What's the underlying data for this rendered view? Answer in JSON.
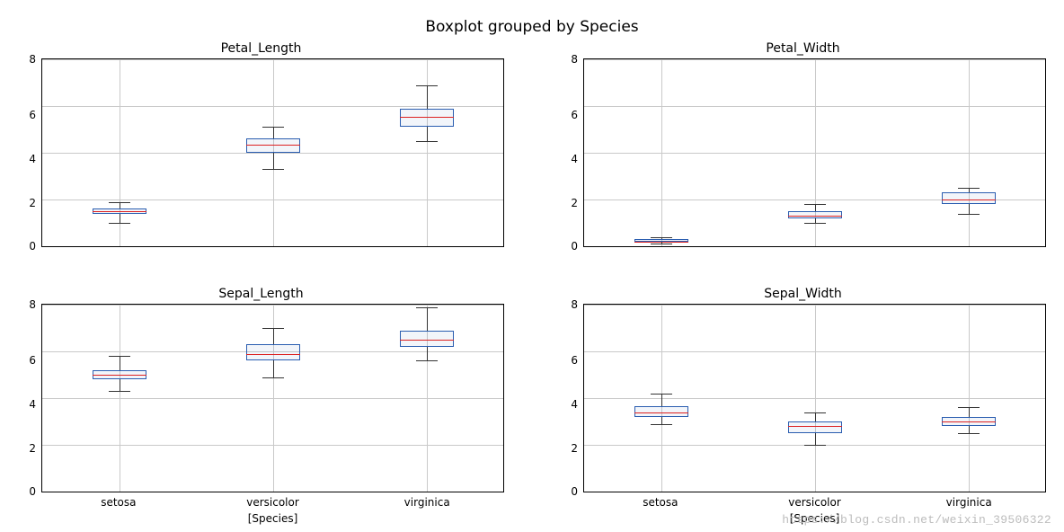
{
  "suptitle": "Boxplot grouped by Species",
  "watermark": "https://blog.csdn.net/weixin_39506322",
  "categories": [
    "setosa",
    "versicolor",
    "virginica"
  ],
  "xlabel": "[Species]",
  "chart_data": [
    {
      "type": "boxplot",
      "title": "Petal_Length",
      "xlabel": "",
      "ylabel": "",
      "ylim": [
        0,
        8
      ],
      "yticks": [
        0,
        2,
        4,
        6,
        8
      ],
      "categories": [
        "setosa",
        "versicolor",
        "virginica"
      ],
      "boxes": [
        {
          "min": 1.0,
          "q1": 1.4,
          "median": 1.5,
          "q3": 1.6,
          "max": 1.9
        },
        {
          "min": 3.3,
          "q1": 4.0,
          "median": 4.35,
          "q3": 4.6,
          "max": 5.1
        },
        {
          "min": 4.5,
          "q1": 5.1,
          "median": 5.55,
          "q3": 5.9,
          "max": 6.9
        }
      ]
    },
    {
      "type": "boxplot",
      "title": "Petal_Width",
      "xlabel": "",
      "ylabel": "",
      "ylim": [
        0,
        8
      ],
      "yticks": [
        0,
        2,
        4,
        6,
        8
      ],
      "categories": [
        "setosa",
        "versicolor",
        "virginica"
      ],
      "boxes": [
        {
          "min": 0.1,
          "q1": 0.2,
          "median": 0.2,
          "q3": 0.3,
          "max": 0.4
        },
        {
          "min": 1.0,
          "q1": 1.2,
          "median": 1.3,
          "q3": 1.5,
          "max": 1.8
        },
        {
          "min": 1.4,
          "q1": 1.8,
          "median": 2.0,
          "q3": 2.3,
          "max": 2.5
        }
      ]
    },
    {
      "type": "boxplot",
      "title": "Sepal_Length",
      "xlabel": "[Species]",
      "ylabel": "",
      "ylim": [
        0,
        8
      ],
      "yticks": [
        0,
        2,
        4,
        6,
        8
      ],
      "categories": [
        "setosa",
        "versicolor",
        "virginica"
      ],
      "boxes": [
        {
          "min": 4.3,
          "q1": 4.8,
          "median": 5.0,
          "q3": 5.2,
          "max": 5.8
        },
        {
          "min": 4.9,
          "q1": 5.6,
          "median": 5.9,
          "q3": 6.3,
          "max": 7.0
        },
        {
          "min": 5.6,
          "q1": 6.2,
          "median": 6.5,
          "q3": 6.9,
          "max": 7.9
        }
      ]
    },
    {
      "type": "boxplot",
      "title": "Sepal_Width",
      "xlabel": "[Species]",
      "ylabel": "",
      "ylim": [
        0,
        8
      ],
      "yticks": [
        0,
        2,
        4,
        6,
        8
      ],
      "categories": [
        "setosa",
        "versicolor",
        "virginica"
      ],
      "boxes": [
        {
          "min": 2.9,
          "q1": 3.2,
          "median": 3.4,
          "q3": 3.65,
          "max": 4.2
        },
        {
          "min": 2.0,
          "q1": 2.5,
          "median": 2.8,
          "q3": 3.0,
          "max": 3.4
        },
        {
          "min": 2.5,
          "q1": 2.8,
          "median": 3.0,
          "q3": 3.2,
          "max": 3.6
        }
      ]
    }
  ]
}
